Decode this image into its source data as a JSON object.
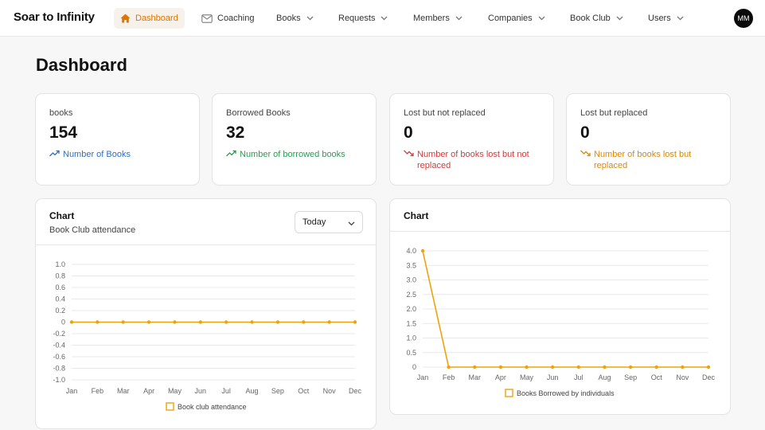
{
  "brand": "Soar to Infinity",
  "nav": {
    "dashboard": "Dashboard",
    "coaching": "Coaching",
    "books": "Books",
    "requests": "Requests",
    "members": "Members",
    "companies": "Companies",
    "book_club": "Book Club",
    "users": "Users",
    "avatar_initials": "MM"
  },
  "page_title": "Dashboard",
  "stats": [
    {
      "label": "books",
      "value": "154",
      "sub": "Number of Books"
    },
    {
      "label": "Borrowed Books",
      "value": "32",
      "sub": "Number of borrowed books"
    },
    {
      "label": "Lost but not replaced",
      "value": "0",
      "sub": "Number of books lost but not replaced"
    },
    {
      "label": "Lost but replaced",
      "value": "0",
      "sub": "Number of books lost but replaced"
    }
  ],
  "colors": {
    "accent": "#d97706",
    "line": "#f0a20b",
    "blue": "#2d6fc7",
    "green": "#2e9a52",
    "red": "#d23b3b",
    "amber": "#d9890b"
  },
  "charts": {
    "left": {
      "title": "Chart",
      "subtitle": "Book Club attendance",
      "filter_value": "Today"
    },
    "right": {
      "title": "Chart"
    }
  },
  "chart_data": [
    {
      "type": "line",
      "categories": [
        "Jan",
        "Feb",
        "Mar",
        "Apr",
        "May",
        "Jun",
        "Jul",
        "Aug",
        "Sep",
        "Oct",
        "Nov",
        "Dec"
      ],
      "series": [
        {
          "name": "Book club attendance",
          "values": [
            0,
            0,
            0,
            0,
            0,
            0,
            0,
            0,
            0,
            0,
            0,
            0
          ]
        }
      ],
      "ylim": [
        -1.0,
        1.0
      ],
      "yticks": [
        "1.0",
        "0.8",
        "0.6",
        "0.4",
        "0.2",
        "0",
        "-0.2",
        "-0.4",
        "-0.6",
        "-0.8",
        "-1.0"
      ],
      "grid": true,
      "legend": "bottom"
    },
    {
      "type": "line",
      "categories": [
        "Jan",
        "Feb",
        "Mar",
        "Apr",
        "May",
        "Jun",
        "Jul",
        "Aug",
        "Sep",
        "Oct",
        "Nov",
        "Dec"
      ],
      "series": [
        {
          "name": "Books Borrowed by individuals",
          "values": [
            4,
            0,
            0,
            0,
            0,
            0,
            0,
            0,
            0,
            0,
            0,
            0
          ]
        }
      ],
      "ylim": [
        0,
        4.0
      ],
      "yticks": [
        "4.0",
        "3.5",
        "3.0",
        "2.5",
        "2.0",
        "1.5",
        "1.0",
        "0.5",
        "0"
      ],
      "grid": true,
      "legend": "bottom"
    }
  ]
}
